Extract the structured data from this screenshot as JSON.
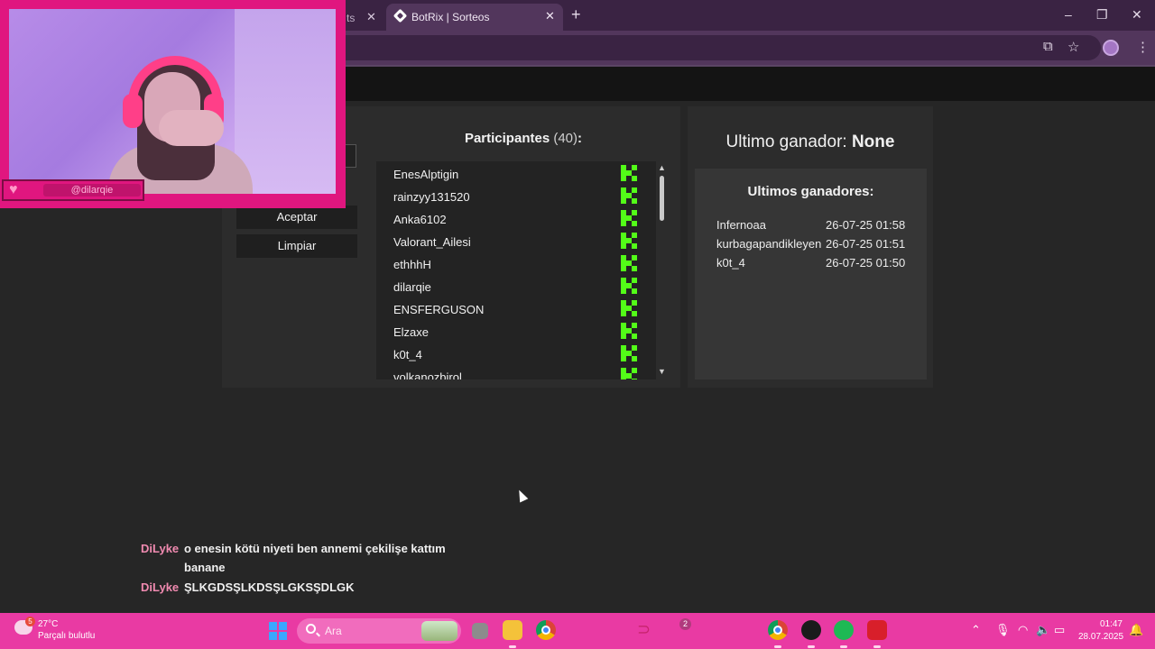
{
  "browser": {
    "prev_tab_label": "ts",
    "active_tab_title": "BotRix | Sorteos",
    "close_glyph": "✕",
    "new_tab_glyph": "+",
    "window_controls": [
      "–",
      "❐",
      "✕"
    ],
    "toolbar_icons": [
      "translate-icon",
      "star-icon",
      "profile-icon",
      "kebab-menu-icon"
    ]
  },
  "raffle": {
    "accept_label": "Aceptar",
    "clear_label": "Limpiar",
    "participants_label": "Participantes",
    "participants_count": "(40)",
    "participants_colon": ":",
    "participants": [
      "EnesAlptigin",
      "rainzyy131520",
      "Anka6102",
      "Valorant_Ailesi",
      "ethhhH",
      "dilarqie",
      "ENSFERGUSON",
      "Elzaxe",
      "k0t_4",
      "volkanozbirol"
    ],
    "platform_icon": "kick-icon",
    "platform_color": "#53fc18",
    "last_winner_label": "Ultimo ganador:",
    "last_winner_value": "None",
    "winners_title": "Ultimos ganadores:",
    "winners": [
      {
        "name": "Infernoaa",
        "date": "26-07-25 01:58"
      },
      {
        "name": "kurbagapandikleyen",
        "date": "26-07-25 01:51"
      },
      {
        "name": "k0t_4",
        "date": "26-07-25 01:50"
      }
    ]
  },
  "stream": {
    "cam_username": "@dilarqie",
    "overlay_color": "#e0167f",
    "chat": [
      {
        "user": "DiLyke",
        "lines": [
          "o enesin kötü niyeti ben annemi çekilişe kattım",
          "banane"
        ]
      },
      {
        "user": "DiLyke",
        "lines": [
          "ŞLKGDSŞLKDSŞLGKSŞDLGK"
        ]
      }
    ]
  },
  "taskbar": {
    "weather_badge": "5",
    "temperature": "27°C",
    "condition": "Parçalı bulutlu",
    "search_placeholder": "Ara",
    "notification_count": "2",
    "time": "01:47",
    "date": "28.07.2025",
    "accent_color": "#e93aa3"
  }
}
